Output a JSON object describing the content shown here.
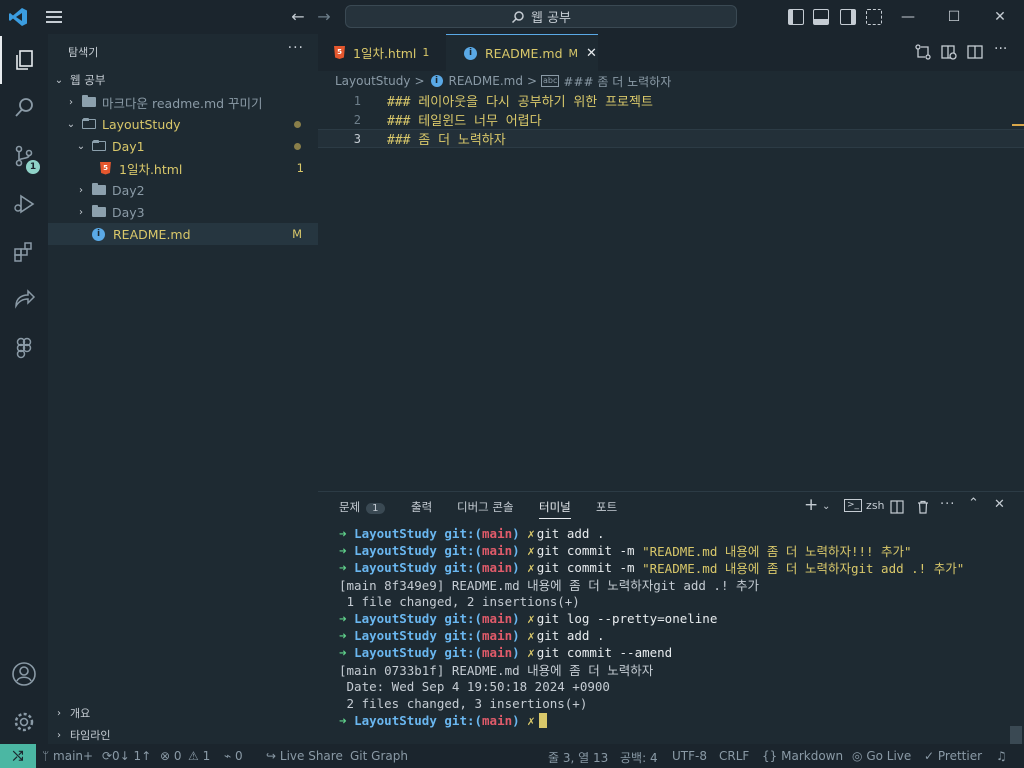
{
  "titlebar": {
    "search_text": "웹 공부",
    "nav_back": "←",
    "nav_forward": "→",
    "minimize": "—",
    "maximize": "☐",
    "close": "✕"
  },
  "sidebar": {
    "title": "탐색기",
    "more": "···",
    "root": "웹 공부",
    "items": [
      {
        "label": "마크다운 readme.md 꾸미기",
        "type": "folder"
      },
      {
        "label": "LayoutStudy",
        "type": "folder-open"
      },
      {
        "label": "Day1",
        "type": "folder-open"
      },
      {
        "label": "1일차.html",
        "type": "html",
        "deco": "1"
      },
      {
        "label": "Day2",
        "type": "folder"
      },
      {
        "label": "Day3",
        "type": "folder"
      },
      {
        "label": "README.md",
        "type": "info",
        "deco": "M"
      }
    ],
    "outline": "개요",
    "timeline": "타임라인"
  },
  "activity": {
    "scm_badge": "1"
  },
  "tabs": [
    {
      "label": "1일차.html",
      "deco": "1",
      "active": false
    },
    {
      "label": "README.md",
      "deco": "M",
      "active": true
    }
  ],
  "breadcrumb": {
    "folder": "LayoutStudy",
    "file": "README.md",
    "symbol": "### 좀 더 노력하자",
    "sep": ">"
  },
  "editor": {
    "lines": [
      {
        "num": "1",
        "hash": "###",
        "text": " 레이아웃을 다시 공부하기 위한 프로젝트"
      },
      {
        "num": "2",
        "hash": "###",
        "text": " 테일윈드 너무 어렵다"
      },
      {
        "num": "3",
        "hash": "###",
        "text": " 좀 더 노력하자"
      }
    ]
  },
  "panel": {
    "tabs": [
      "문제",
      "출력",
      "디버그 콘솔",
      "터미널",
      "포트"
    ],
    "problems_count": "1",
    "shell": "zsh",
    "add": "+",
    "terminal": {
      "prompt_dir": "LayoutStudy",
      "prompt_git": "git:(",
      "prompt_branch": "main",
      "prompt_close": ")",
      "prompt_arrow": "➜",
      "prompt_x": "✗",
      "lines": [
        {
          "type": "cmd",
          "cmd": "git add .",
          "str": ""
        },
        {
          "type": "cmd",
          "cmd": "git commit -m ",
          "str": "\"README.md 내용에 좀 더 노력하자!!! 추가\""
        },
        {
          "type": "cmd",
          "cmd": "git commit -m ",
          "str": "\"README.md 내용에 좀 더 노력하자git add .! 추가\""
        },
        {
          "type": "out",
          "text": "[main 8f349e9] README.md 내용에 좀 더 노력하자git add .! 추가"
        },
        {
          "type": "out",
          "text": " 1 file changed, 2 insertions(+)"
        },
        {
          "type": "cmd",
          "cmd": "git log --pretty=oneline",
          "str": ""
        },
        {
          "type": "cmd",
          "cmd": "git add .",
          "str": ""
        },
        {
          "type": "cmd",
          "cmd": "git commit --amend",
          "str": ""
        },
        {
          "type": "out",
          "text": "[main 0733b1f] README.md 내용에 좀 더 노력하자"
        },
        {
          "type": "out",
          "text": " Date: Wed Sep 4 19:50:18 2024 +0900"
        },
        {
          "type": "out",
          "text": " 2 files changed, 3 insertions(+)"
        },
        {
          "type": "prompt",
          "cmd": "",
          "str": ""
        }
      ]
    }
  },
  "statusbar": {
    "remote": "⤭",
    "branch": "main+",
    "sync": "⟳0↓ 1↑",
    "errors": "⊗ 0",
    "warnings": "⚠ 1",
    "ports": "⌁ 0",
    "liveshare": "Live Share",
    "gitgraph": "Git Graph",
    "position": "줄 3, 열 13",
    "spaces": "공백: 4",
    "encoding": "UTF-8",
    "eol": "CRLF",
    "language": "Markdown",
    "golive": "Go Live",
    "prettier": "Prettier"
  }
}
